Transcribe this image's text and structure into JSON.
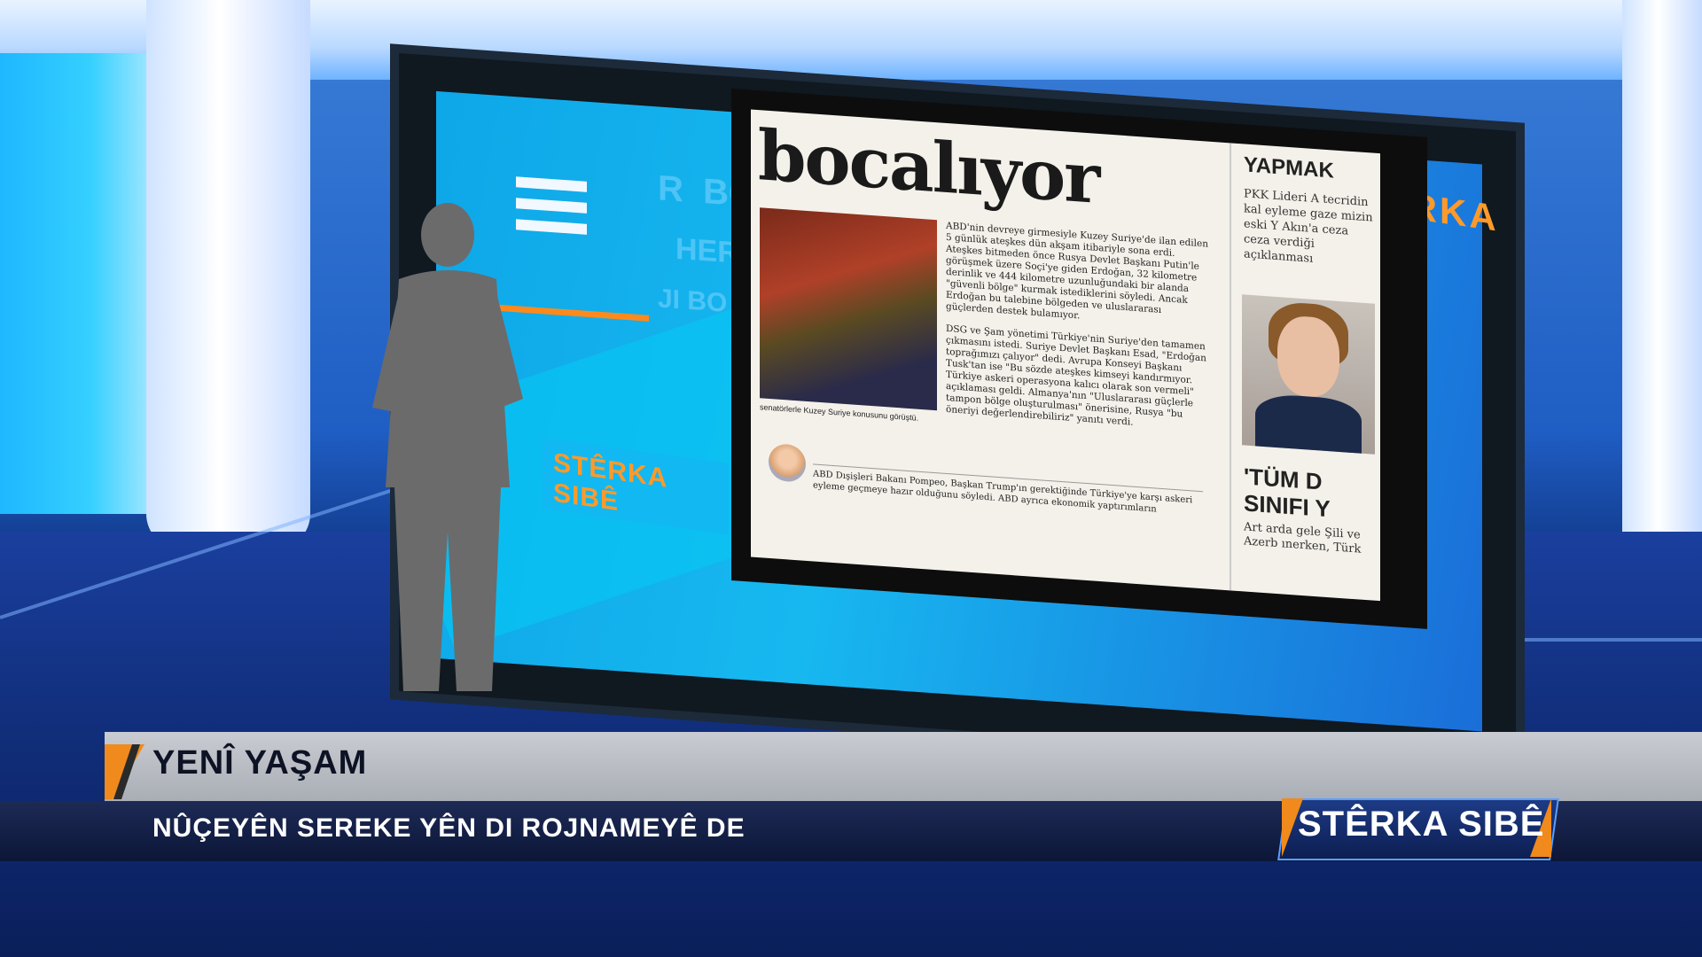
{
  "lower_third": {
    "title": "YENÎ YAŞAM",
    "subtitle": "NÛÇEYÊN SEREKE YÊN DI ROJNAMEYÊ DE",
    "program_logo": "STÊRKA SIBÊ"
  },
  "video_wall": {
    "brand_top": "STÊRKA SIBÊ",
    "brand_mini": "STÊRKA SIBÊ",
    "menu_icon": "hamburger-menu-icon"
  },
  "newspaper": {
    "headline": "bocalıyor",
    "photo_caption": "senatörlerle Kuzey Suriye konusunu görüştü.",
    "article_paragraphs": [
      "ABD'nin devreye girmesiyle Kuzey Suriye'de ilan edilen 5 günlük ateşkes dün akşam itibariyle sona erdi. Ateşkes bitmeden önce Rusya Devlet Başkanı Putin'le görüşmek üzere Soçi'ye giden Erdoğan, 32 kilometre derinlik ve 444 kilometre uzunluğundaki bir alanda \"güvenli bölge\" kurmak istediklerini söyledi. Ancak Erdoğan bu talebine bölgeden ve uluslararası güçlerden destek bulamıyor.",
      "DSG ve Şam yönetimi Türkiye'nin Suriye'den tamamen çıkmasını istedi. Suriye Devlet Başkanı Esad, \"Erdoğan toprağımızı çalıyor\" dedi. Avrupa Konseyi Başkanı Tusk'tan ise \"Bu sözde ateşkes kimseyi kandırmıyor. Türkiye askeri operasyona kalıcı olarak son vermeli\" açıklaması geldi. Almanya'nın \"Uluslararası güçlerle tampon bölge oluşturulması\" önerisine, Rusya \"bu öneriyi değerlendirebiliriz\" yanıtı verdi."
    ],
    "footer_text": "ABD Dışişleri Bakanı Pompeo, Başkan Trump'ın gerektiğinde Türkiye'ye karşı askeri eyleme geçmeye hazır olduğunu söyledi. ABD ayrıca ekonomik yaptırımların",
    "right_column": {
      "title": "YAPMAK",
      "text": "PKK Lideri A tecridin kal eyleme gaze mizin eski Y Akın'a ceza ceza verdiği açıklanması",
      "headline2_line1": "'TÜM D",
      "headline2_line2": "SINIFI Y",
      "text2": "Art arda gele Şili ve Azerb ınerken, Türk"
    }
  },
  "colors": {
    "accent_orange": "#f08a1c",
    "lower_third_blue": "#0c1638",
    "lower_third_grey": "#b9bcc3",
    "wall_cyan": "#17b8f0"
  }
}
